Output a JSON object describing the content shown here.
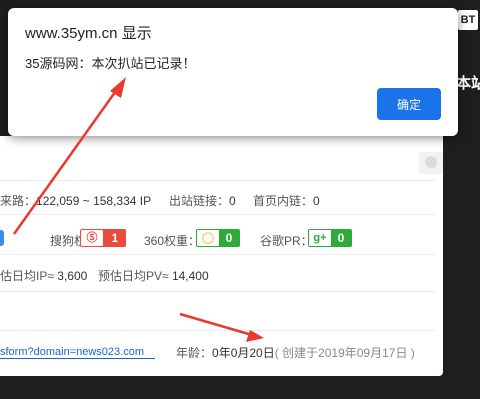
{
  "topbar": {
    "bt_label": "BT",
    "side_label": "本站"
  },
  "dialog": {
    "title": "www.35ym.cn 显示",
    "message": "35源码网：本次扒站已记录！",
    "ok_label": "确定"
  },
  "stats": {
    "source_label": "来路：",
    "source_value": "122,059 ~ 158,334 IP",
    "outlinks_label": "出站链接：",
    "outlinks_value": "0",
    "homelinks_label": "首页内链：",
    "homelinks_value": "0"
  },
  "weights": {
    "sogou_label": "搜狗权重：",
    "sogou_value": "1",
    "w360_label": "360权重：",
    "w360_value": "0",
    "google_label": "谷歌PR：",
    "google_value": "0"
  },
  "estimates": {
    "ip_label": "估日均IP≈",
    "ip_value": "3,600",
    "pv_label": "预估日均PV≈",
    "pv_value": "14,400"
  },
  "domain_row": {
    "link_text": "sform?domain=news023.com",
    "age_label": "年龄：",
    "age_value": "0年0月20日",
    "created_text": "( 创建于2019年09月17日 )"
  },
  "colors": {
    "ok_button": "#1a73e8",
    "sogou_badge": "#e84c3d",
    "w360_badge": "#2eaa3a",
    "google_badge": "#2eaa3a",
    "arrow": "#e83a2e"
  }
}
